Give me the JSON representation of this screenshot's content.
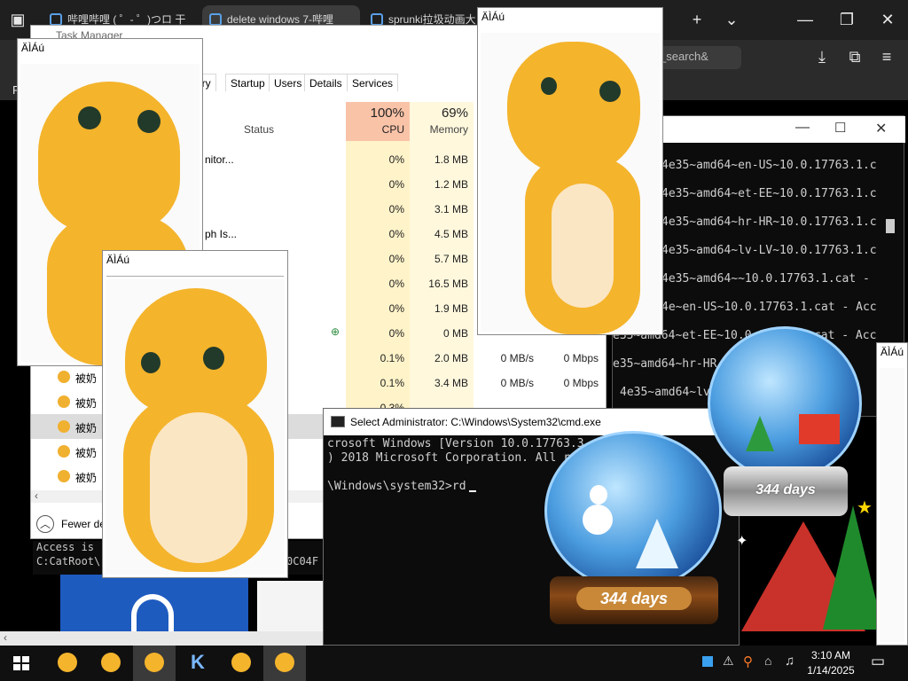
{
  "browser": {
    "tabs": [
      {
        "label": "哔哩哔哩 ( ゜- ゜)つロ 干"
      },
      {
        "label": "delete windows 7-哔哩"
      },
      {
        "label": "sprunki拉圾动画大"
      }
    ],
    "url_fragment": "_search&"
  },
  "taskmgr": {
    "title": "Task Manager",
    "tabs": [
      "ory",
      "Startup",
      "Users",
      "Details",
      "Services"
    ],
    "status_header": "Status",
    "cpu_pct": "100%",
    "cpu_label": "CPU",
    "mem_pct": "69%",
    "mem_label": "Memory",
    "partial_names": [
      "nitor...",
      "ph Is..."
    ],
    "rows": [
      {
        "cpu": "0%",
        "mem": "1.8 MB"
      },
      {
        "cpu": "0%",
        "mem": "1.2 MB"
      },
      {
        "cpu": "0%",
        "mem": "3.1 MB"
      },
      {
        "cpu": "0%",
        "mem": "4.5 MB"
      },
      {
        "cpu": "0%",
        "mem": "5.7 MB"
      },
      {
        "cpu": "0%",
        "mem": "16.5 MB"
      },
      {
        "cpu": "0%",
        "mem": "1.9 MB"
      },
      {
        "cpu": "0%",
        "mem": "0 MB"
      },
      {
        "cpu": "0.1%",
        "mem": "2.0 MB",
        "disk": "0 MB/s",
        "net": "0 Mbps"
      },
      {
        "cpu": "0.1%",
        "mem": "3.4 MB",
        "disk": "0 MB/s",
        "net": "0 Mbps"
      },
      {
        "cpu": "0.3%",
        "mem": "",
        "disk": "",
        "net": ""
      }
    ],
    "proc_names": [
      "被奶",
      "被奶",
      "被奶",
      "被奶",
      "被奶"
    ],
    "fewer_details": "Fewer de"
  },
  "cmd_back": {
    "lines": [
      "4e35~amd64~en-US~10.0.17763.1.c",
      "4e35~amd64~et-EE~10.0.17763.1.c",
      "4e35~amd64~hr-HR~10.0.17763.1.c",
      "4e35~amd64~lv-LV~10.0.17763.1.c",
      "4e35~amd64~~10.0.17763.1.cat -",
      "4e~en-US~10.0.17763.1.cat - Acc",
      "e35~amd64~et-EE~10.0.17763.1.cat - Acc",
      "e35~amd64~hr-HR",
      "4e35~amd64~lv-"
    ]
  },
  "cmd_small": {
    "lines": [
      "Access is",
      "C:CatRoot\\",
      "0C04F"
    ]
  },
  "cmd_front": {
    "title": "Select Administrator: C:\\Windows\\System32\\cmd.exe",
    "lines": [
      "crosoft Windows [Version 10.0.17763.3",
      ") 2018 Microsoft Corporation. All r",
      "",
      "\\Windows\\system32>rd"
    ]
  },
  "popups": [
    {
      "title": "ÄÌÁú"
    },
    {
      "title": "ÄÌÁú"
    },
    {
      "title": "ÄÌÁú"
    },
    {
      "title": "ÄÌÁú"
    }
  ],
  "globes": [
    {
      "days": "344 days"
    },
    {
      "days": "344 days"
    }
  ],
  "taskbar": {
    "clock_time": "3:10 AM",
    "clock_date": "1/14/2025",
    "k_app": "K"
  },
  "colors": {
    "cpu_header": "#f9c3a8",
    "cpu_column": "#fff3c9",
    "taskbar": "#101010",
    "duck": "#f4b42c"
  }
}
